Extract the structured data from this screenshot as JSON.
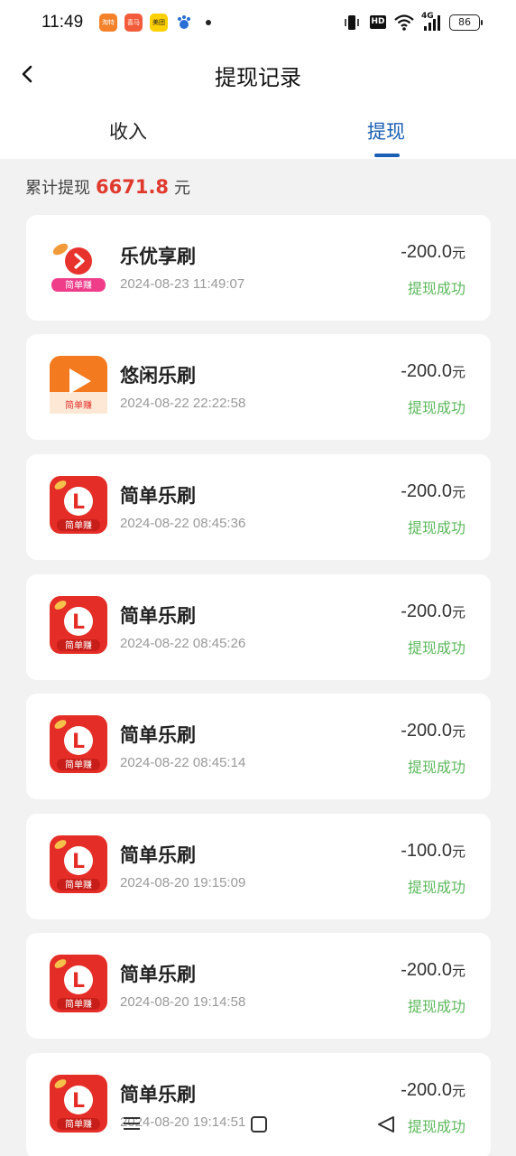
{
  "status_bar": {
    "time": "11:49",
    "app_icon_1": "淘特",
    "app_icon_2": "喜马",
    "app_icon_3": "美团",
    "network": "4G",
    "hd": "HD",
    "battery": "86"
  },
  "header": {
    "title": "提现记录",
    "back_icon": "chevron-left-icon"
  },
  "tabs": [
    {
      "label": "收入",
      "active": false
    },
    {
      "label": "提现",
      "active": true
    }
  ],
  "accent_color": "#1a5fb4",
  "summary": {
    "label": "累计提现",
    "amount": "6671.8",
    "unit": "元"
  },
  "records": [
    {
      "app": "乐优享刷",
      "icon": "leyouxiang-app-icon",
      "time": "2024-08-23 11:49:07",
      "amount": "-200.0",
      "unit": "元",
      "status": "提现成功"
    },
    {
      "app": "悠闲乐刷",
      "icon": "youxian-app-icon",
      "time": "2024-08-22 22:22:58",
      "amount": "-200.0",
      "unit": "元",
      "status": "提现成功"
    },
    {
      "app": "简单乐刷",
      "icon": "jiandan-app-icon",
      "time": "2024-08-22 08:45:36",
      "amount": "-200.0",
      "unit": "元",
      "status": "提现成功"
    },
    {
      "app": "简单乐刷",
      "icon": "jiandan-app-icon",
      "time": "2024-08-22 08:45:26",
      "amount": "-200.0",
      "unit": "元",
      "status": "提现成功"
    },
    {
      "app": "简单乐刷",
      "icon": "jiandan-app-icon",
      "time": "2024-08-22 08:45:14",
      "amount": "-200.0",
      "unit": "元",
      "status": "提现成功"
    },
    {
      "app": "简单乐刷",
      "icon": "jiandan-app-icon",
      "time": "2024-08-20 19:15:09",
      "amount": "-100.0",
      "unit": "元",
      "status": "提现成功"
    },
    {
      "app": "简单乐刷",
      "icon": "jiandan-app-icon",
      "time": "2024-08-20 19:14:58",
      "amount": "-200.0",
      "unit": "元",
      "status": "提现成功"
    },
    {
      "app": "简单乐刷",
      "icon": "jiandan-app-icon",
      "time": "2024-08-20 19:14:51",
      "amount": "-200.0",
      "unit": "元",
      "status": "提现成功"
    }
  ],
  "icon_badge_text": "简单赚",
  "status_color": "#5cb85c",
  "amount_color": "#e03a2f"
}
